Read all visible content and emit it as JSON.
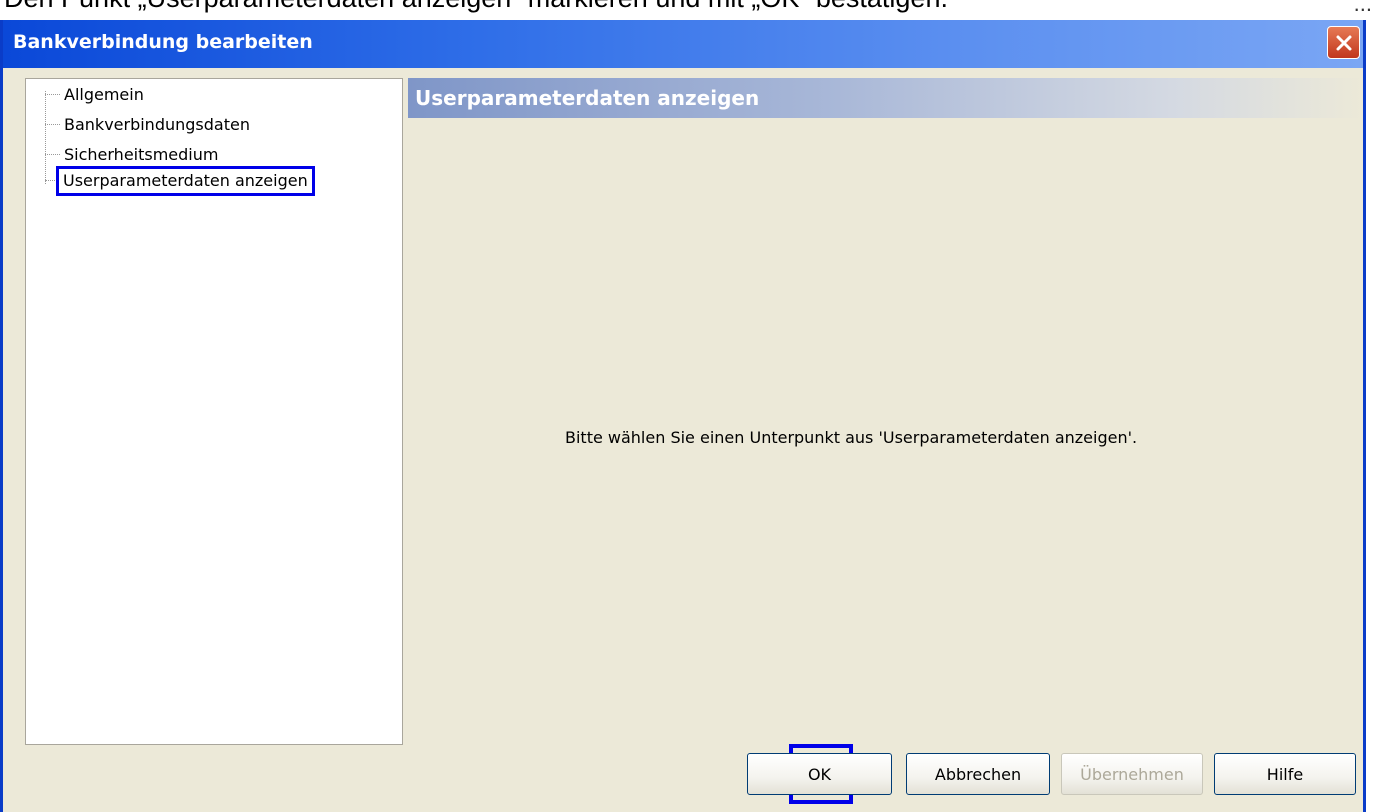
{
  "instruction_text": "Den Punkt „Userparameterdaten anzeigen“ markieren und mit „OK“ bestätigen.",
  "corner_text": "...",
  "dialog": {
    "title": "Bankverbindung bearbeiten",
    "close_symbol": "×"
  },
  "tree": {
    "items": [
      {
        "label": "Allgemein"
      },
      {
        "label": "Bankverbindungsdaten"
      },
      {
        "label": "Sicherheitsmedium"
      },
      {
        "label": "Userparameterdaten anzeigen",
        "selected": true
      }
    ]
  },
  "content": {
    "header": "Userparameterdaten anzeigen",
    "hint": "Bitte wählen Sie einen Unterpunkt aus 'Userparameterdaten anzeigen'."
  },
  "buttons": {
    "ok": "OK",
    "cancel": "Abbrechen",
    "apply": "Übernehmen",
    "help": "Hilfe"
  },
  "icons": [
    "close-icon"
  ],
  "colors": {
    "titlebar": "#0a48d8",
    "highlight": "#0000e8",
    "dialog_bg": "#ece9d8"
  }
}
